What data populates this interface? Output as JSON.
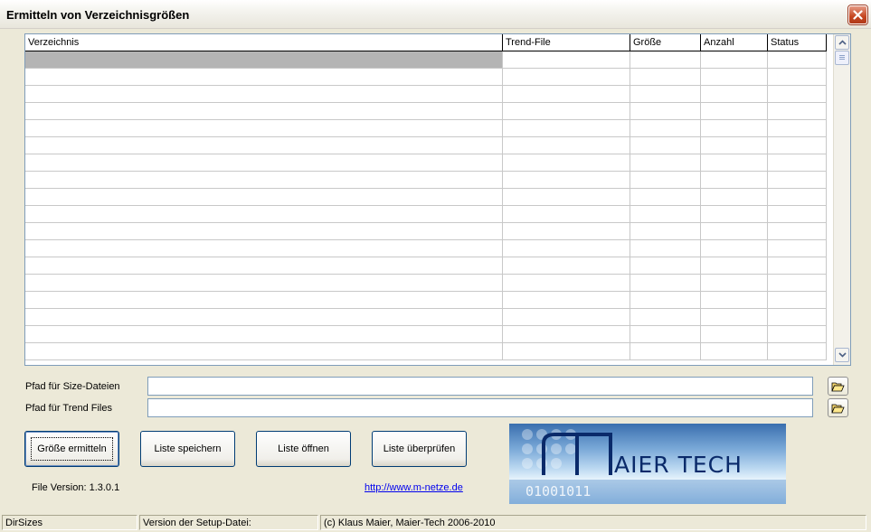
{
  "window": {
    "title": "Ermitteln von Verzeichnisgrößen"
  },
  "table": {
    "columns": [
      "Verzeichnis",
      "Trend-File",
      "Größe",
      "Anzahl",
      "Status"
    ],
    "row_count": 18
  },
  "paths": {
    "size_label": "Pfad für Size-Dateien",
    "size_value": "",
    "trend_label": "Pfad für Trend Files",
    "trend_value": ""
  },
  "buttons": {
    "calc": "Größe ermitteln",
    "save": "Liste speichern",
    "open": "Liste öffnen",
    "check": "Liste überprüfen"
  },
  "file_version": "File Version: 1.3.0.1",
  "link": "http://www.m-netze.de",
  "logo": {
    "text": "AIER TECH",
    "binary": "01001011"
  },
  "status": {
    "app": "DirSizes",
    "setup_version": "Version der Setup-Datei:",
    "copyright": "(c) Klaus Maier, Maier-Tech 2006-2010"
  },
  "colors": {
    "selection": "#b4b4b4",
    "close_button": "#c5451f",
    "link": "#0000ee"
  }
}
